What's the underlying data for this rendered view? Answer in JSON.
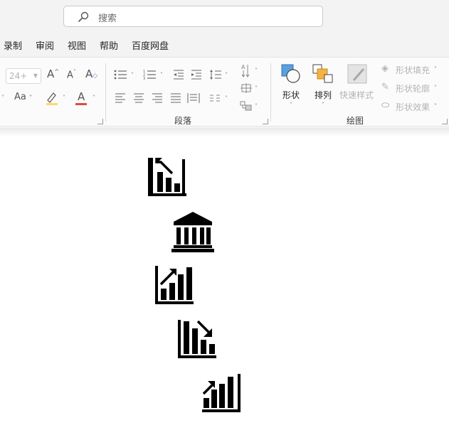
{
  "search": {
    "placeholder": "搜索",
    "icon": "search-icon"
  },
  "tabs": [
    {
      "label": "录制",
      "active": false
    },
    {
      "label": "审阅",
      "active": true
    },
    {
      "label": "视图",
      "active": false
    },
    {
      "label": "帮助",
      "active": false
    },
    {
      "label": "百度网盘",
      "active": false
    }
  ],
  "font_group": {
    "size_value": "24+",
    "aa_label": "Aa",
    "font_color_letter": "A",
    "grow_font_letter": "A",
    "shrink_font_letter": "A",
    "clear_format_letter": "A"
  },
  "paragraph_group": {
    "label": "段落"
  },
  "drawing_group": {
    "label": "绘图",
    "shape_label": "形状",
    "arrange_label": "排列",
    "quick_style_label": "快速样式",
    "shape_fill_label": "形状填充",
    "shape_outline_label": "形状轮廓",
    "shape_effect_label": "形状效果"
  },
  "colors": {
    "highlight_yellow": "#ffd966",
    "font_red": "#e04b3c",
    "shape_blue": "#5aa0e0",
    "arrange_orange": "#f5b342"
  },
  "document_icons": [
    {
      "name": "chart-decrease-icon"
    },
    {
      "name": "bank-building-icon"
    },
    {
      "name": "chart-increase-icon"
    },
    {
      "name": "chart-decrease-arrow-icon"
    },
    {
      "name": "chart-growth-icon"
    }
  ]
}
